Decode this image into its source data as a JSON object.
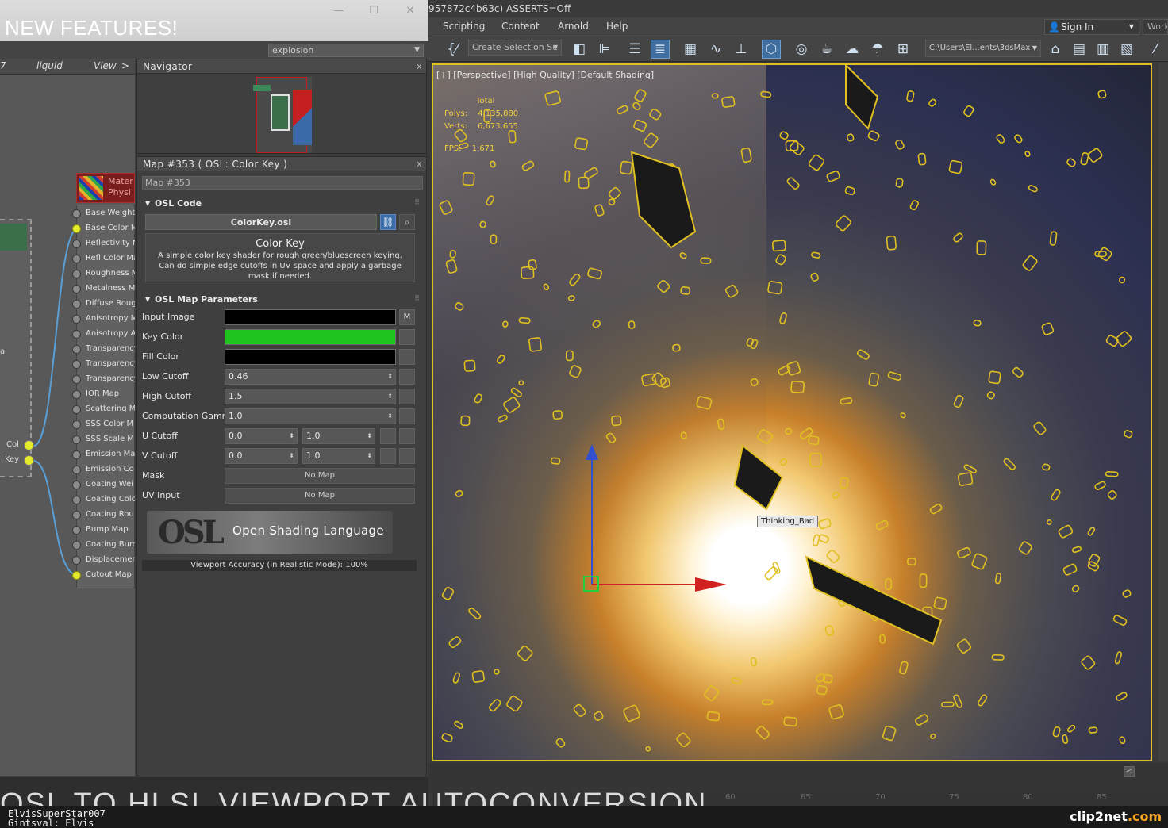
{
  "banner": {
    "title": "NEW FEATURES!"
  },
  "left_window": {
    "view_dropdown": "explosion",
    "tabs": [
      "7",
      "liquid",
      "View",
      ">"
    ],
    "minimize": "—",
    "maximize": "☐",
    "close": "✕"
  },
  "navigator": {
    "title": "Navigator",
    "close": "x"
  },
  "node": {
    "title_line1": "Mater",
    "title_line2": "Physi",
    "slots": [
      "Base Weight",
      "Base Color M",
      "Reflectivity M",
      "Refl Color Ma",
      "Roughness M",
      "Metalness M",
      "Diffuse Roug",
      "Anisotropy M",
      "Anisotropy A",
      "Transparency",
      "Transparency",
      "Transparency",
      "IOR Map",
      "Scattering M",
      "SSS Color M",
      "SSS Scale M",
      "Emission Ma",
      "Emission Co",
      "Coating Wei",
      "Coating Colo",
      "Coating Rou",
      "Bump Map",
      "Coating Bum",
      "Displacemen",
      "Cutout Map"
    ],
    "left_node_slots": [
      "Col",
      "Key"
    ],
    "left_node_side_label": "a"
  },
  "params": {
    "title": "Map #353  ( OSL: Color Key )",
    "close": "x",
    "map_name": "Map #353",
    "osl_code_header": "OSL Code",
    "osl_file": "ColorKey.osl",
    "desc_title": "Color Key",
    "desc_body": "A simple color key shader for rough green/bluescreen keying. Can do simple edge cutoffs in UV space and apply a garbage mask if needed.",
    "map_params_header": "OSL Map Parameters",
    "rows": {
      "input_image": "Input Image",
      "key_color": "Key Color",
      "fill_color": "Fill Color",
      "low_cutoff": "Low Cutoff",
      "low_cutoff_val": "0.46",
      "high_cutoff": "High Cutoff",
      "high_cutoff_val": "1.5",
      "comp_gamma": "Computation Gamma",
      "comp_gamma_val": "1.0",
      "u_cutoff": "U Cutoff",
      "u_cutoff_a": "0.0",
      "u_cutoff_b": "1.0",
      "v_cutoff": "V Cutoff",
      "v_cutoff_a": "0.0",
      "v_cutoff_b": "1.0",
      "mask": "Mask",
      "uv_input": "UV Input",
      "no_map": "No Map",
      "m_button": "M"
    },
    "logo_mark": "OSL",
    "logo_text": "Open Shading Language",
    "viewport_accuracy": "Viewport Accuracy (in Realistic Mode): 100%"
  },
  "colors": {
    "input_image": "#000000",
    "key_color": "#1fc41f",
    "fill_color": "#000000",
    "accent": "#3e6d9e",
    "selection_outline": "#e0c020"
  },
  "app": {
    "title": "957872c4b63c) ASSERTS=Off",
    "menu": [
      "Scripting",
      "Content",
      "Arnold",
      "Help"
    ],
    "sign_in": "Sign In",
    "workspace": "Work",
    "selection_set": "Create Selection Se",
    "path": "C:\\Users\\El...ents\\3dsMax"
  },
  "viewport": {
    "label": "[+] [Perspective] [High Quality] [Default Shading]",
    "stats_total": "Total",
    "stats_polys_label": "Polys:",
    "stats_polys": "4,135,880",
    "stats_verts_label": "Verts:",
    "stats_verts": "6,673,655",
    "stats_fps_label": "FPS:",
    "stats_fps": "1.671",
    "tooltip": "Thinking_Bad"
  },
  "timeline": {
    "ticks": [
      "60",
      "65",
      "70",
      "75",
      "80",
      "85"
    ]
  },
  "caption": "OSL TO HLSL VIEWPORT AUTOCONVERSION",
  "footer": {
    "user_line1": "ElvisSuperStar007",
    "user_line2": "Gintsval: Elvis",
    "brand_main": "clip2net",
    "brand_sub": ".com"
  }
}
